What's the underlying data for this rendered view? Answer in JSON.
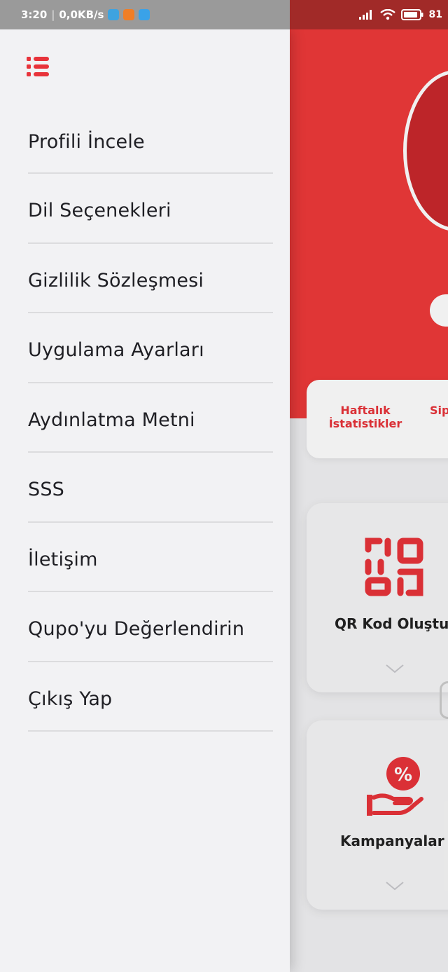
{
  "status_bar": {
    "time": "3:20",
    "network_speed": "0,0KB/s",
    "battery": "81"
  },
  "drawer": {
    "menu_icon": "list-menu-icon",
    "items": [
      {
        "label": "Profili İncele"
      },
      {
        "label": "Dil Seçenekleri"
      },
      {
        "label": "Gizlilik Sözleşmesi"
      },
      {
        "label": "Uygulama Ayarları"
      },
      {
        "label": "Aydınlatma Metni"
      },
      {
        "label": "SSS"
      },
      {
        "label": "İletişim"
      },
      {
        "label": "Qupo'yu Değerlendirin"
      },
      {
        "label": "Çıkış Yap"
      }
    ]
  },
  "background_app": {
    "stats_card": {
      "title": "Haftalık İstatistikler",
      "second_tab": "Sip"
    },
    "features": [
      {
        "label": "QR Kod Oluştu",
        "icon": "qr-code-icon"
      },
      {
        "label": "Kampanyalar",
        "icon": "discount-hand-icon"
      }
    ]
  },
  "colors": {
    "accent": "#ef3a3a",
    "drawer_bg": "#f2f2f4",
    "text": "#1f1f24"
  }
}
